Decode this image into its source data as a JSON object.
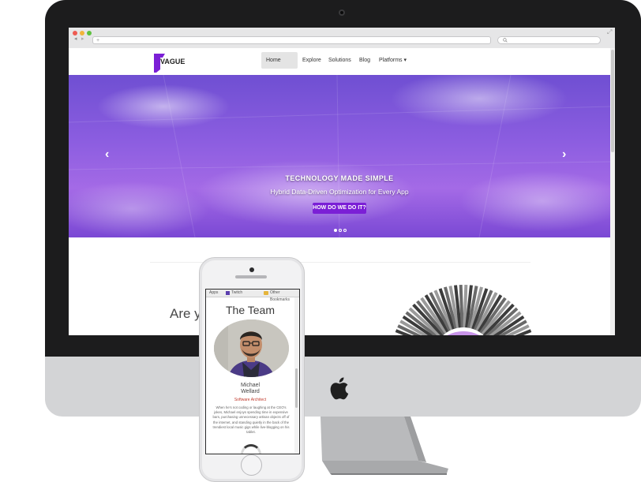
{
  "browser": {
    "url_placeholder": "+",
    "search_placeholder": "",
    "nav_back": "◂",
    "nav_forward": "▸",
    "fullscreen": "⤢"
  },
  "site": {
    "logo_text": "VAGUE",
    "nav": [
      {
        "label": "Home"
      },
      {
        "label": "Explore"
      },
      {
        "label": "Solutions"
      },
      {
        "label": "Blog"
      },
      {
        "label": "Platforms ▾"
      }
    ],
    "hero": {
      "title": "TECHNOLOGY MADE SIMPLE",
      "subtitle": "Hybrid Data-Driven Optimization for Every App",
      "button": "HOW DO WE DO IT?",
      "prev": "‹",
      "next": "›"
    },
    "tagline": "Are y                       xt level?"
  },
  "phone": {
    "bookmarks": [
      "Apps",
      "Twitch",
      "Other Bookmarks"
    ],
    "team_title": "The Team",
    "member_first": "Michael",
    "member_last": "Wellard",
    "member_role": "Software Architect",
    "member_bio": "When he's not coding or laughing at the CEO's jokes, Michael enjoys spending time in expensive bars, purchasing unnecessary artisan objects off of the internet, and standing quietly in the back of the trendiest local music gigs while live-blogging on his tablet."
  },
  "colors": {
    "brand_purple": "#7b1fd6",
    "hero_top": "#6f4fd2",
    "hero_bottom": "#7a48d4",
    "role_red": "#c0392b"
  }
}
